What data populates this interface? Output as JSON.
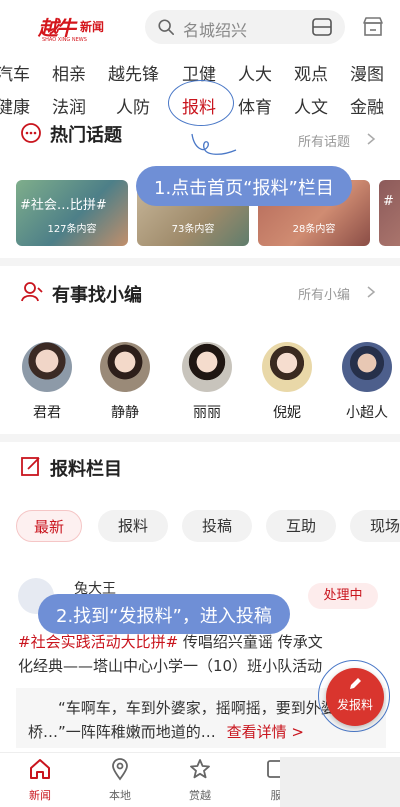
{
  "header": {
    "logo_text": "越牛",
    "logo_sub": "新闻",
    "logo_en": "SHAO XING NEWS",
    "search_placeholder": "名城绍兴"
  },
  "channels_row1": [
    "汽车",
    "相亲",
    "越先锋",
    "卫健",
    "人大",
    "观点",
    "漫图"
  ],
  "channels_row2": [
    "健康",
    "法润",
    "人防",
    "报料",
    "体育",
    "人文",
    "金融"
  ],
  "hot_topics": {
    "title": "热门话题",
    "more": "所有话题",
    "cards": [
      {
        "title": "#社会…比拼#",
        "count": "127条内容"
      },
      {
        "title": "",
        "count": "73条内容"
      },
      {
        "title": "",
        "count": "28条内容"
      },
      {
        "title": "#",
        "count": ""
      }
    ]
  },
  "callout1": "1.点击首页“报料”栏目",
  "editors": {
    "title": "有事找小编",
    "more": "所有小编",
    "items": [
      {
        "name": "君君"
      },
      {
        "name": "静静"
      },
      {
        "name": "丽丽"
      },
      {
        "name": "倪妮"
      },
      {
        "name": "小超人"
      }
    ]
  },
  "report": {
    "title": "报料栏目",
    "pills": [
      "最新",
      "报料",
      "投稿",
      "互助",
      "现场"
    ]
  },
  "post": {
    "author": "兔大王",
    "status": "处理中",
    "tag": "#社会实践活动大比拼#",
    "text_a": "传唱绍兴童谣 传承文",
    "text_b": "化经典——塔山中心小学一（10）班小队活动",
    "quote_a": "“车啊车，车到外婆家，摇啊摇，要到外婆",
    "quote_b": "桥…”一阵阵稚嫩而地道的…",
    "more": "查看详情 >"
  },
  "callout2": "2.找到“发报料”，进入投稿",
  "fab_label": "发报料",
  "nav": [
    {
      "label": "新闻",
      "icon": "home-icon"
    },
    {
      "label": "本地",
      "icon": "location-icon"
    },
    {
      "label": "赏越",
      "icon": "star-icon"
    },
    {
      "label": "服",
      "icon": "service-icon"
    }
  ],
  "colors": {
    "brand": "#c9151e",
    "callout": "#6f8fd6",
    "highlight": "#4a78c7"
  }
}
